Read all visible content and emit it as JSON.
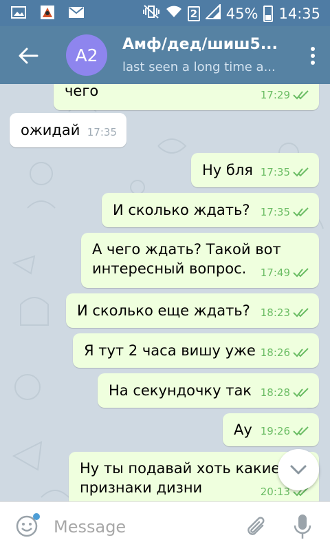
{
  "status_bar": {
    "icons": [
      "image-notification-icon",
      "app-notification-icon",
      "mail-icon",
      "mute-vibrate-icon",
      "wifi-icon",
      "sim-2-icon",
      "signal-icon",
      "battery-icon"
    ],
    "sim": "2",
    "battery": "45%",
    "time": "14:35"
  },
  "header": {
    "avatar_initials": "A2",
    "avatar_color": "#8e85ee",
    "title": "Амф/дед/шиш5...",
    "subtitle": "last seen a long time a..."
  },
  "messages": [
    {
      "dir": "out",
      "text_lines": [
        "чего"
      ],
      "time": "17:29",
      "read": true
    },
    {
      "dir": "in",
      "text_lines": [
        "ожидай"
      ],
      "time": "17:35"
    },
    {
      "dir": "out",
      "text_lines": [
        "Ну бля"
      ],
      "time": "17:35",
      "read": true
    },
    {
      "dir": "out",
      "text_lines": [
        "И сколько ждать?"
      ],
      "time": "17:35",
      "read": true
    },
    {
      "dir": "out",
      "text_lines": [
        "А чего ждать? Такой вот",
        "интересный вопрос."
      ],
      "time": "17:49",
      "read": true
    },
    {
      "dir": "out",
      "text_lines": [
        "И сколько еще ждать?"
      ],
      "time": "18:23",
      "read": true
    },
    {
      "dir": "out",
      "text_lines": [
        "Я тут 2 часа вишу уже"
      ],
      "time": "18:26",
      "read": true
    },
    {
      "dir": "out",
      "text_lines": [
        "На секундочку так"
      ],
      "time": "18:28",
      "read": true
    },
    {
      "dir": "out",
      "text_lines": [
        "Ау"
      ],
      "time": "19:26",
      "read": true
    },
    {
      "dir": "out",
      "text_lines": [
        "Ну ты подавай хоть какие",
        "признаки дизни"
      ],
      "time": "20:13",
      "read": true
    }
  ],
  "input": {
    "placeholder": "Message"
  },
  "colors": {
    "header": "#5682a3",
    "status_bar": "#4f7ca4",
    "outgoing_bubble": "#efffde",
    "incoming_bubble": "#ffffff",
    "read_checks": "#6bbd64",
    "chat_background": "#cfd9e2"
  }
}
